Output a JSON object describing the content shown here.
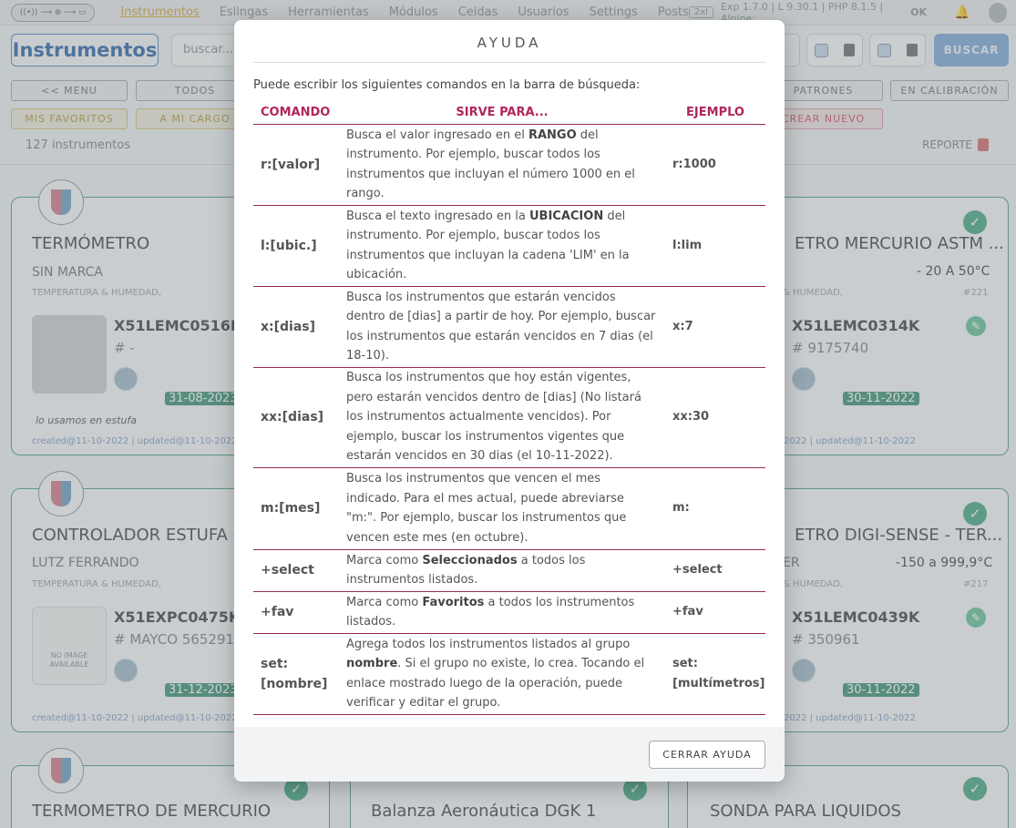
{
  "nav": {
    "logo": "((•)) ⟶ ⊕ ⟶ ▭",
    "links": [
      "Instrumentos",
      "Eslingas",
      "Herramientas",
      "Módulos",
      "Celdas",
      "Usuarios",
      "Settings",
      "Posts"
    ],
    "badge": "2xl",
    "version_prefix": "Exp 1.7.0 | L 9.30.1 | PHP 8.1.5 | Alpine:",
    "version_status": "OK"
  },
  "page": {
    "title": "Instrumentos",
    "search_placeholder": "buscar...",
    "search_button": "BUSCAR",
    "filters_row1": [
      "<< MENU",
      "TODOS",
      "PATRONES",
      "EN CALIBRACIÓN"
    ],
    "filters_row2": [
      "MIS FAVORITOS",
      "A MI CARGO",
      "CREAR NUEVO"
    ],
    "count": "127 instrumentos",
    "reporte": "REPORTE"
  },
  "cards": {
    "c1": {
      "title": "TERMÓMETRO",
      "brand": "SIN MARCA",
      "category": "TEMPERATURA & HUMEDAD,",
      "code": "X51LEMC0516K",
      "serial": "# -",
      "date": "31-08-2023",
      "note": "lo usamos en estufa",
      "meta": "created@11-10-2022 | updated@11-10-2022"
    },
    "c2": {
      "title": "ETRO MERCURIO ASTM ...",
      "range": "- 20 A 50°C",
      "category": "& HUMEDAD,",
      "id": "#221",
      "code": "X51LEMC0314K",
      "serial": "# 9175740",
      "date": "30-11-2022",
      "meta": "2022 | updated@11-10-2022"
    },
    "c3": {
      "title": "CONTROLADOR ESTUFA -",
      "brand": "LUTZ FERRANDO",
      "category": "TEMPERATURA & HUMEDAD,",
      "code": "X51EXPC0475K",
      "serial": "# MAYCO 565291",
      "date": "31-12-2023",
      "noimage": "NO IMAGE AVAILABLE",
      "meta": "created@11-10-2022 | updated@11-10-2022"
    },
    "c4": {
      "title": "ETRO DIGI-SENSE - TER...",
      "brand": "ER",
      "range": "-150 a 999,9°C",
      "category": "& HUMEDAD,",
      "id": "#217",
      "code": "X51LEMC0439K",
      "serial": "# 350961",
      "date": "30-11-2022",
      "meta": "2022 | updated@11-10-2022"
    },
    "c5": {
      "title": "TERMOMETRO DE MERCURIO"
    },
    "c6": {
      "title": "Balanza Aeronáutica DGK 1"
    },
    "c7": {
      "title": "SONDA PARA LIQUIDOS"
    }
  },
  "modal": {
    "title": "AYUDA",
    "intro": "Puede escribir los siguientes comandos en la barra de búsqueda:",
    "headers": {
      "command": "COMANDO",
      "purpose": "SIRVE PARA...",
      "example": "EJEMPLO"
    },
    "rows": [
      {
        "command": "r:[valor]",
        "desc_pre": "Busca el valor ingresado en el ",
        "desc_bold": "RANGO",
        "desc_post": " del instrumento. Por ejemplo, buscar todos los instrumentos que incluyan el número 1000 en el rango.",
        "example": "r:1000"
      },
      {
        "command": "l:[ubic.]",
        "desc_pre": "Busca el texto ingresado en la ",
        "desc_bold": "UBICACION",
        "desc_post": " del instrumento. Por ejemplo, buscar todos los instrumentos que incluyan la cadena 'LIM' en la ubicación.",
        "example": "l:lim"
      },
      {
        "command": "x:[dias]",
        "desc_pre": "Busca los instrumentos que estarán vencidos dentro de [dias] a partir de hoy. Por ejemplo, buscar los instrumentos que estarán vencidos en 7 dias (el 18-10).",
        "desc_bold": "",
        "desc_post": "",
        "example": "x:7"
      },
      {
        "command": "xx:[dias]",
        "desc_pre": "Busca los instrumentos que hoy están vigentes, pero estarán vencidos dentro de [dias] (No listará los instrumentos actualmente vencidos). Por ejemplo, buscar los instrumentos vigentes que estarán vencidos en 30 dias (el 10-11-2022).",
        "desc_bold": "",
        "desc_post": "",
        "example": "xx:30"
      },
      {
        "command": "m:[mes]",
        "desc_pre": "Busca los instrumentos que vencen el mes indicado. Para el mes actual, puede abreviarse \"m:\". Por ejemplo, buscar los instrumentos que vencen este mes (en octubre).",
        "desc_bold": "",
        "desc_post": "",
        "example": "m:"
      },
      {
        "command": "+select",
        "desc_pre": "Marca como ",
        "desc_bold": "Seleccionados",
        "desc_post": " a todos los instrumentos listados.",
        "example": "+select"
      },
      {
        "command": "+fav",
        "desc_pre": "Marca como ",
        "desc_bold": "Favoritos",
        "desc_post": " a todos los instrumentos listados.",
        "example": "+fav"
      },
      {
        "command": "set:[nombre]",
        "desc_pre": "Agrega todos los instrumentos listados al grupo ",
        "desc_bold": "nombre",
        "desc_post": ". Si el grupo no existe, lo crea. Tocando el enlace mostrado luego de la operación, puede verificar y editar el grupo.",
        "example": "set:[multímetros]"
      }
    ],
    "close_button": "CERRAR AYUDA"
  }
}
